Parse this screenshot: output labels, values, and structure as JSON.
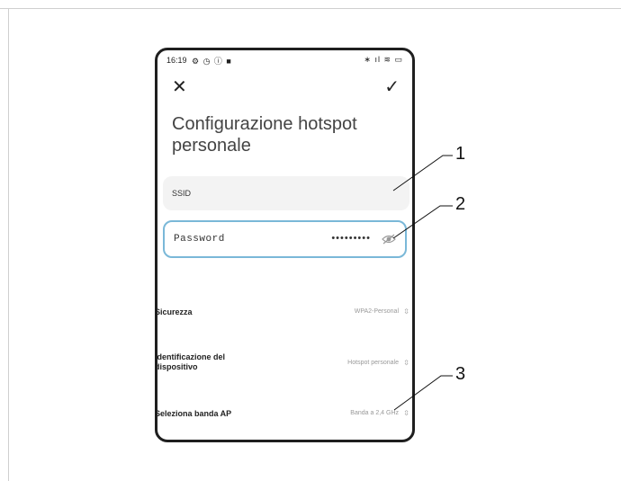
{
  "status_bar": {
    "time": "16:19",
    "left_icons": "⚙ ◷ ⓘ ■",
    "right_icons": "∗ ıl ≋ ▭"
  },
  "header": {
    "close_icon": "close-icon",
    "confirm_icon": "check-icon",
    "title": "Configurazione hotspot personale"
  },
  "fields": {
    "ssid_label": "SSID",
    "password_label": "Password",
    "password_value": "•••••••••"
  },
  "settings": [
    {
      "label": "Sicurezza",
      "value": "WPA2-Personal"
    },
    {
      "label": "Identificazione del dispositivo",
      "value": "Hotspot personale"
    },
    {
      "label": "Seleziona banda AP",
      "value": "Banda a 2,4 GHz"
    }
  ],
  "callouts": [
    "1",
    "2",
    "3"
  ],
  "colors": {
    "focus_border": "#7ab8d8",
    "field_bg": "#f3f3f3",
    "frame": "#1f1f1f"
  }
}
